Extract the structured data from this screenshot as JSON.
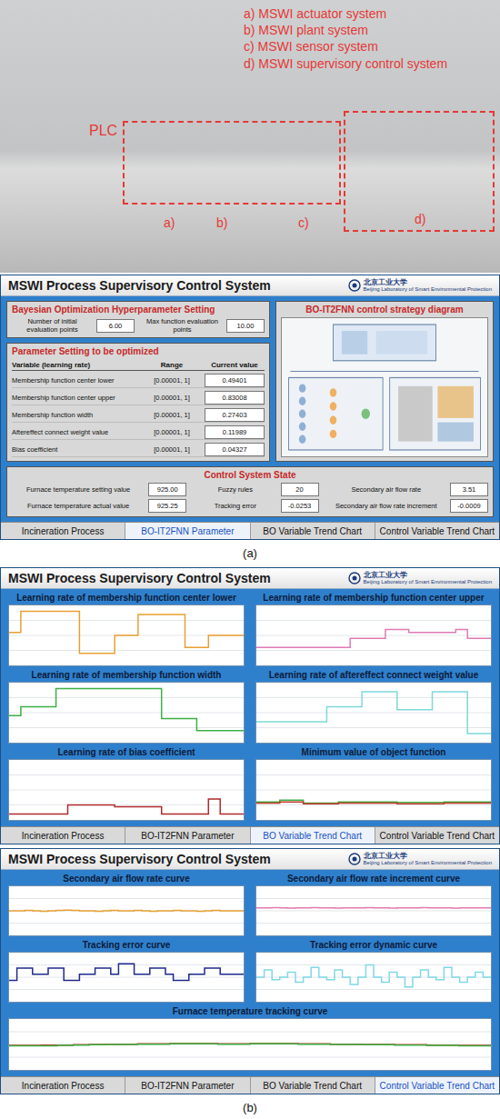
{
  "photo": {
    "labels": [
      "a) MSWI actuator system",
      "b) MSWI plant system",
      "c) MSWI sensor system",
      "d) MSWI supervisory control system"
    ],
    "plc": "PLC",
    "markers": [
      "a)",
      "b)",
      "c)",
      "d)"
    ]
  },
  "header": {
    "title": "MSWI Process Supervisory Control System",
    "logo": "北京工业大学",
    "lab": "Beijing Laboratory of Smart Environmental Protection"
  },
  "screen_a": {
    "bo_settings": {
      "title": "Bayesian Optimization Hyperparameter Setting",
      "fields": [
        {
          "label": "Number of initial evaluation points",
          "value": "6.00"
        },
        {
          "label": "Max function evaluation points",
          "value": "10.00"
        }
      ]
    },
    "params": {
      "title": "Parameter Setting to be optimized",
      "columns": [
        "Variable (learning rate)",
        "Range",
        "Current value"
      ],
      "rows": [
        [
          "Membership function center lower",
          "[0.00001, 1]",
          "0.49401"
        ],
        [
          "Membership function center upper",
          "[0.00001, 1]",
          "0.83008"
        ],
        [
          "Membership function width",
          "[0.00001, 1]",
          "0.27403"
        ],
        [
          "Aftereffect connect weight value",
          "[0.00001, 1]",
          "0.11989"
        ],
        [
          "Bias coefficient",
          "[0.00001, 1]",
          "0.04327"
        ]
      ]
    },
    "diagram": {
      "title": "BO-IT2FNN control strategy diagram"
    },
    "state": {
      "title": "Control System State",
      "fields": [
        {
          "label": "Furnace temperature setting value",
          "value": "925.00"
        },
        {
          "label": "Fuzzy rules",
          "value": "20"
        },
        {
          "label": "Secondary air flow rate",
          "value": "3.51"
        },
        {
          "label": "Furnace temperature actual value",
          "value": "925.25"
        },
        {
          "label": "Tracking error",
          "value": "-0.0253"
        },
        {
          "label": "Secondary air flow rate increment",
          "value": "-0.0009"
        }
      ]
    },
    "tabs": [
      {
        "label": "Incineration Process",
        "selected": false
      },
      {
        "label": "BO-IT2FNN Parameter",
        "selected": true
      },
      {
        "label": "BO Variable Trend Chart",
        "selected": false
      },
      {
        "label": "Control Variable Trend Chart",
        "selected": false
      }
    ]
  },
  "caption_a": "(a)",
  "screen_b1": {
    "charts": [
      {
        "title": "Learning rate of membership function center lower",
        "y_min": 0,
        "y_max": 1,
        "series": [
          {
            "color": "#e8a033",
            "values": [
              0.55,
              0.9,
              0.9,
              0.9,
              0.9,
              0.9,
              0.2,
              0.2,
              0.2,
              0.5,
              0.5,
              0.85,
              0.85,
              0.85,
              0.85,
              0.3,
              0.3,
              0.5,
              0.5,
              0.5
            ]
          }
        ]
      },
      {
        "title": "Learning rate of membership function center upper",
        "y_min": 0,
        "y_max": 1,
        "series": [
          {
            "color": "#e07bb5",
            "values": [
              0.3,
              0.3,
              0.3,
              0.3,
              0.3,
              0.3,
              0.3,
              0.3,
              0.45,
              0.45,
              0.45,
              0.6,
              0.6,
              0.55,
              0.55,
              0.55,
              0.55,
              0.6,
              0.45,
              0.45
            ]
          }
        ]
      },
      {
        "title": "Learning rate of membership function width",
        "y_min": 0,
        "y_max": 1,
        "series": [
          {
            "color": "#3cb043",
            "values": [
              0.45,
              0.6,
              0.6,
              0.6,
              0.9,
              0.9,
              0.9,
              0.9,
              0.9,
              0.9,
              0.9,
              0.9,
              0.9,
              0.4,
              0.4,
              0.4,
              0.2,
              0.2,
              0.2,
              0.2
            ]
          }
        ]
      },
      {
        "title": "Learning rate of aftereffect connect weight value",
        "y_min": 0,
        "y_max": 1,
        "series": [
          {
            "color": "#7fd8d8",
            "values": [
              0.35,
              0.35,
              0.35,
              0.35,
              0.35,
              0.35,
              0.6,
              0.6,
              0.6,
              0.85,
              0.85,
              0.85,
              0.55,
              0.55,
              0.55,
              0.85,
              0.85,
              0.85,
              0.15,
              0.15
            ]
          }
        ]
      },
      {
        "title": "Learning rate of bias coefficient",
        "y_min": 0,
        "y_max": 1,
        "series": [
          {
            "color": "#b02a2a",
            "values": [
              0.1,
              0.1,
              0.1,
              0.1,
              0.1,
              0.25,
              0.25,
              0.25,
              0.25,
              0.22,
              0.22,
              0.22,
              0.22,
              0.1,
              0.1,
              0.1,
              0.1,
              0.35,
              0.1,
              0.1
            ]
          }
        ]
      },
      {
        "title": "Minimum value of object function",
        "y_min": 0,
        "y_max": 1,
        "series": [
          {
            "color": "#3cb043",
            "values": [
              0.3,
              0.3,
              0.33,
              0.33,
              0.28,
              0.28,
              0.28,
              0.3,
              0.3,
              0.3,
              0.3,
              0.3,
              0.29,
              0.29,
              0.29,
              0.29,
              0.3,
              0.3,
              0.3,
              0.3
            ]
          },
          {
            "color": "#c0392b",
            "values": [
              0.28,
              0.28,
              0.3,
              0.3,
              0.27,
              0.27,
              0.27,
              0.28,
              0.28,
              0.28,
              0.28,
              0.28,
              0.27,
              0.27,
              0.27,
              0.27,
              0.28,
              0.28,
              0.28,
              0.28
            ]
          }
        ]
      }
    ],
    "tabs": [
      {
        "label": "Incineration Process",
        "selected": false
      },
      {
        "label": "BO-IT2FNN Parameter",
        "selected": false
      },
      {
        "label": "BO Variable Trend Chart",
        "selected": true
      },
      {
        "label": "Control Variable Trend Chart",
        "selected": false
      }
    ]
  },
  "screen_b2": {
    "charts": [
      {
        "title": "Secondary air flow rate curve",
        "y_min": 0,
        "y_max": 7,
        "series": [
          {
            "color": "#e8a033",
            "values": [
              3.5,
              3.5,
              3.55,
              3.5,
              3.45,
              3.5,
              3.55,
              3.6,
              3.55,
              3.5,
              3.5,
              3.45,
              3.5,
              3.55,
              3.5,
              3.5,
              3.55,
              3.5,
              3.45,
              3.5,
              3.5,
              3.55,
              3.5,
              3.5,
              3.45,
              3.5,
              3.55,
              3.5,
              3.5,
              3.5
            ]
          }
        ]
      },
      {
        "title": "Secondary air flow rate increment curve",
        "y_min": -0.1,
        "y_max": 0.1,
        "series": [
          {
            "color": "#e07bb5",
            "values": [
              0.012,
              0.012,
              0.013,
              0.012,
              0.011,
              0.012,
              0.012,
              0.013,
              0.012,
              0.012,
              0.011,
              0.012,
              0.012,
              0.012,
              0.013,
              0.012,
              0.012,
              0.011,
              0.012,
              0.012,
              0.012,
              0.013,
              0.012,
              0.012,
              0.012,
              0.011,
              0.012,
              0.012,
              0.012,
              0.012
            ]
          }
        ]
      },
      {
        "title": "Tracking error curve",
        "y_min": -4,
        "y_max": 4,
        "series": [
          {
            "color": "#1f2a8a",
            "values": [
              -0.5,
              1.5,
              1.5,
              0.5,
              0.5,
              1.5,
              1.5,
              -0.5,
              -0.5,
              0.5,
              0.5,
              1.5,
              1.5,
              0.5,
              2.2,
              2.2,
              0.5,
              0.5,
              1.5,
              1.5,
              0.5,
              -0.5,
              -0.5,
              0.5,
              0.5,
              1.5,
              1.5,
              0.5,
              0.5,
              0.5
            ]
          }
        ]
      },
      {
        "title": "Tracking error dynamic curve",
        "y_min": -1,
        "y_max": 1,
        "series": [
          {
            "color": "#7fd8e6",
            "values": [
              0.0,
              0.3,
              -0.1,
              0.0,
              0.2,
              -0.2,
              0.0,
              0.4,
              0.0,
              -0.1,
              0.3,
              0.0,
              -0.3,
              0.0,
              0.5,
              0.0,
              -0.2,
              0.2,
              0.0,
              -0.4,
              0.0,
              0.3,
              0.0,
              -0.1,
              0.4,
              0.0,
              -0.2,
              0.0,
              0.2,
              0.0
            ]
          }
        ]
      },
      {
        "title": "Furnace temperature tracking curve",
        "y_min": 850,
        "y_max": 1000,
        "series": [
          {
            "color": "#c0392b",
            "values": [
              922,
              922,
              923,
              923,
              924,
              925,
              926,
              926,
              927,
              927,
              928,
              928,
              928,
              927,
              927,
              928,
              928,
              928,
              927,
              927,
              926,
              926,
              925,
              925,
              924,
              924,
              923,
              923,
              922,
              922
            ]
          },
          {
            "color": "#3cb043",
            "values": [
              921,
              921,
              921,
              922,
              923,
              924,
              925,
              925,
              926,
              926,
              927,
              927,
              927,
              926,
              926,
              927,
              927,
              927,
              926,
              926,
              925,
              925,
              924,
              924,
              923,
              923,
              922,
              922,
              921,
              921
            ]
          }
        ]
      }
    ],
    "tabs": [
      {
        "label": "Incineration Process",
        "selected": false
      },
      {
        "label": "BO-IT2FNN Parameter",
        "selected": false
      },
      {
        "label": "BO Variable Trend Chart",
        "selected": false
      },
      {
        "label": "Control Variable Trend Chart",
        "selected": true
      }
    ]
  },
  "caption_b": "(b)"
}
